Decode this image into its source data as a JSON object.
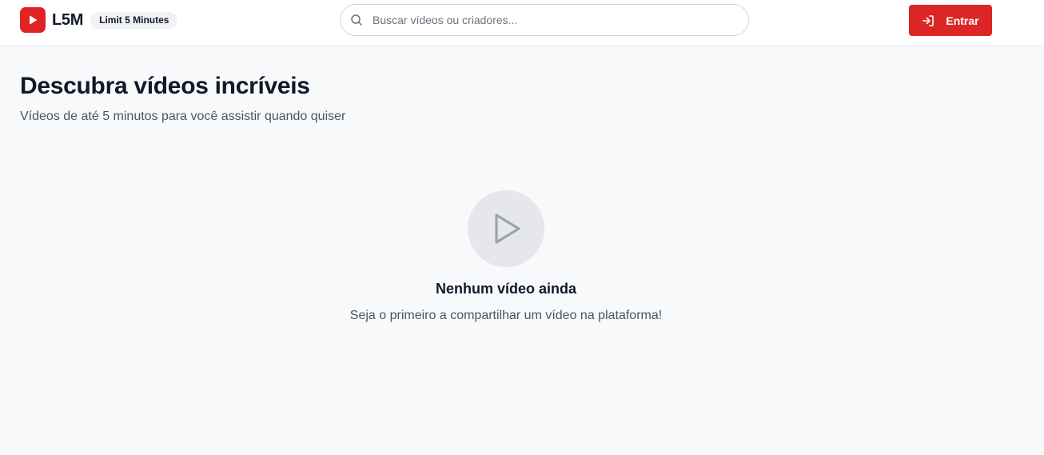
{
  "header": {
    "logo_text": "L5M",
    "tagline": "Limit 5 Minutes",
    "search": {
      "placeholder": "Buscar vídeos ou criadores...",
      "value": ""
    },
    "login_label": "Entrar"
  },
  "main": {
    "title": "Descubra vídeos incríveis",
    "subtitle": "Vídeos de até 5 minutos para você assistir quando quiser",
    "empty_state": {
      "title": "Nenhum vídeo ainda",
      "message": "Seja o primeiro a compartilhar um vídeo na plataforma!"
    }
  },
  "icons": {
    "logo": "play-icon",
    "search": "search-icon",
    "login": "log-in-icon",
    "empty": "play-outline-icon"
  },
  "colors": {
    "brand": "#dc2626",
    "background": "#f8f9fb",
    "header_bg": "#ffffff",
    "empty_circle": "#e5e7eb",
    "empty_icon": "#9ca3af",
    "text_primary": "#111827",
    "text_secondary": "#4b5563"
  }
}
